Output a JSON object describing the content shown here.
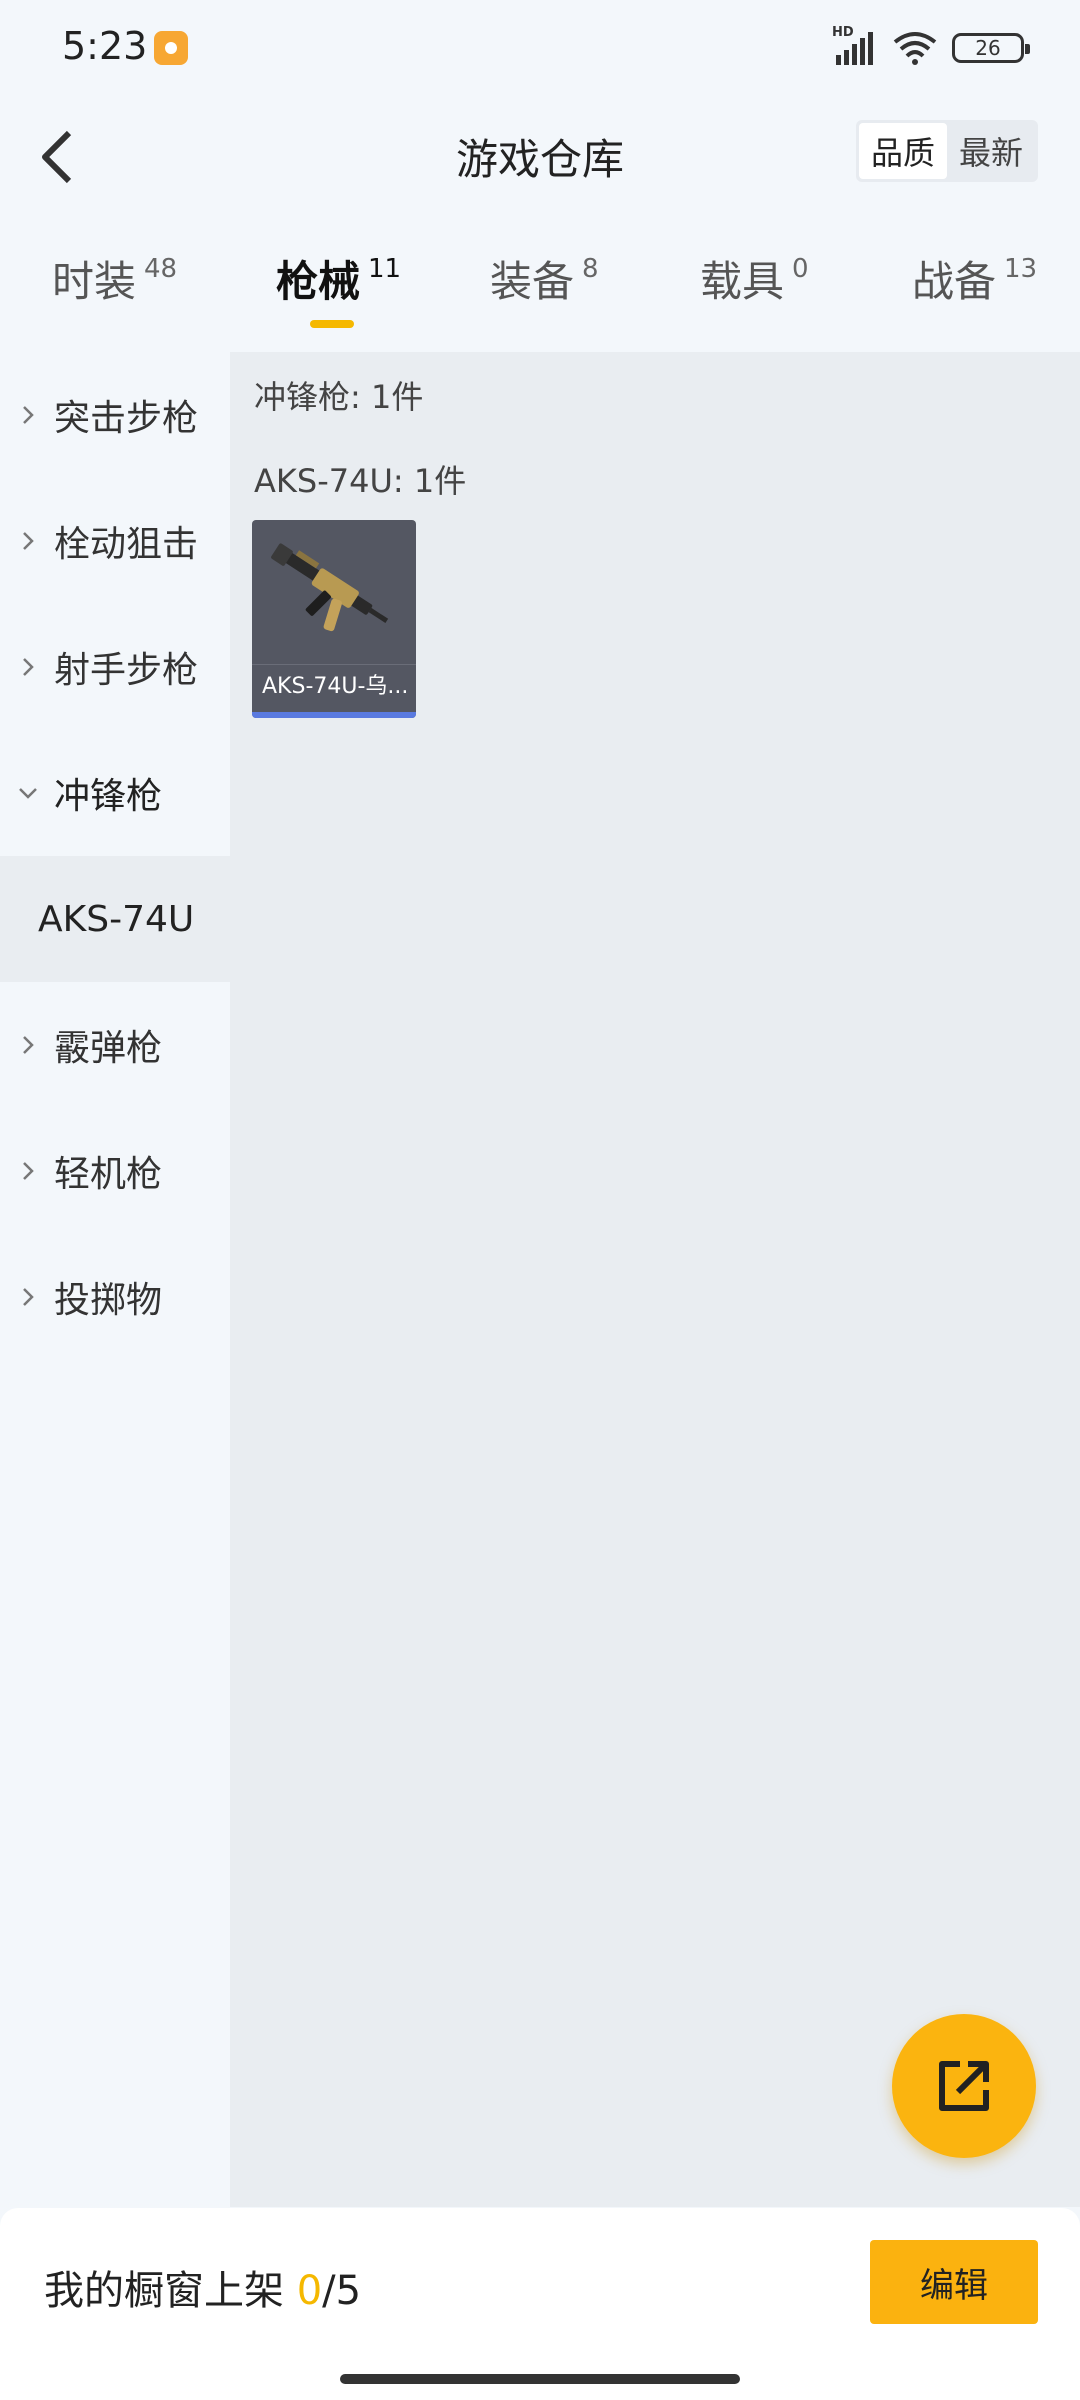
{
  "status_bar": {
    "time": "5:23",
    "app_icon": "orange-app-icon",
    "network_label": "HD",
    "battery": "26"
  },
  "header": {
    "title": "游戏仓库",
    "back_icon": "chevron-left-icon",
    "sort_options": [
      "品质",
      "最新"
    ],
    "sort_selected": "品质"
  },
  "tabs": [
    {
      "label": "时装",
      "count": "48"
    },
    {
      "label": "枪械",
      "count": "11"
    },
    {
      "label": "装备",
      "count": "8"
    },
    {
      "label": "载具",
      "count": "0"
    },
    {
      "label": "战备",
      "count": "13"
    }
  ],
  "active_tab": "枪械",
  "sidebar": {
    "items": [
      {
        "label": "突击步枪"
      },
      {
        "label": "栓动狙击"
      },
      {
        "label": "射手步枪"
      },
      {
        "label": "冲锋枪"
      },
      {
        "label": "AKS-74U"
      },
      {
        "label": "霰弹枪"
      },
      {
        "label": "轻机枪"
      },
      {
        "label": "投掷物"
      }
    ],
    "expanded": "冲锋枪",
    "selected_sub": "AKS-74U"
  },
  "content": {
    "category_title": "冲锋枪: 1件",
    "group_title": "AKS-74U: 1件",
    "items": [
      {
        "name": "AKS-74U-乌...",
        "quality_color": "#5a7ae0"
      }
    ]
  },
  "fab": {
    "icon": "share-external-icon"
  },
  "bottom": {
    "showcase_label": "我的橱窗上架",
    "showcase_count": "0",
    "showcase_total": "/5",
    "edit_label": "编辑"
  },
  "colors": {
    "accent": "#f5b800",
    "quality_blue": "#5a7ae0",
    "card_bg": "#545762"
  }
}
